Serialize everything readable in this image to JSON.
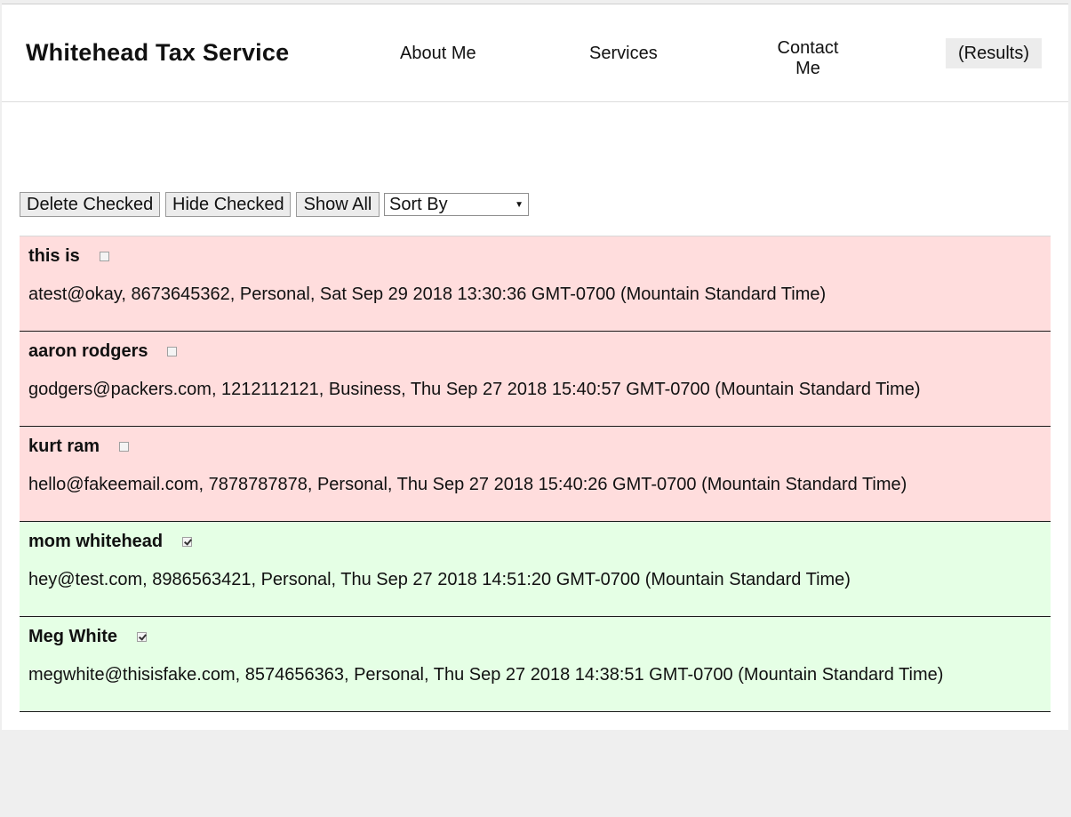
{
  "header": {
    "brand": "Whitehead Tax Service",
    "nav": {
      "about": "About Me",
      "services": "Services",
      "contact": "Contact Me",
      "results": "(Results)"
    }
  },
  "toolbar": {
    "delete_label": "Delete Checked",
    "hide_label": "Hide Checked",
    "show_label": "Show All",
    "sort_value": "Sort By"
  },
  "colors": {
    "unchecked_row": "#ffdddd",
    "checked_row": "#e5ffe5",
    "results_tab_bg": "#ececec"
  },
  "entries": [
    {
      "name": "this is",
      "checked": false,
      "detail": "atest@okay, 8673645362, Personal, Sat Sep 29 2018 13:30:36 GMT-0700 (Mountain Standard Time)"
    },
    {
      "name": "aaron rodgers",
      "checked": false,
      "detail": "godgers@packers.com, 1212112121, Business, Thu Sep 27 2018 15:40:57 GMT-0700 (Mountain Standard Time)"
    },
    {
      "name": "kurt ram",
      "checked": false,
      "detail": "hello@fakeemail.com, 7878787878, Personal, Thu Sep 27 2018 15:40:26 GMT-0700 (Mountain Standard Time)"
    },
    {
      "name": "mom whitehead",
      "checked": true,
      "detail": "hey@test.com, 8986563421, Personal, Thu Sep 27 2018 14:51:20 GMT-0700 (Mountain Standard Time)"
    },
    {
      "name": "Meg White",
      "checked": true,
      "detail": "megwhite@thisisfake.com, 8574656363, Personal, Thu Sep 27 2018 14:38:51 GMT-0700 (Mountain Standard Time)"
    }
  ]
}
